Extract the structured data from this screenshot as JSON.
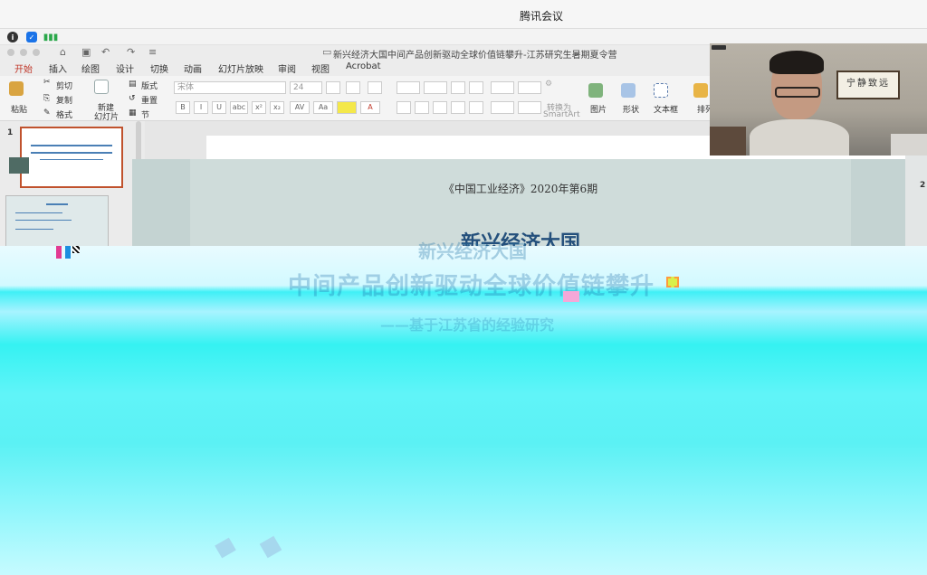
{
  "window": {
    "app_title": "腾讯会议"
  },
  "meeting_toolbar": {
    "info_icon": "info-icon",
    "shield_icon": "shield-icon",
    "signal_icon": "signal-icon"
  },
  "ppt": {
    "doc_title": "新兴经济大国中间产品创新驱动全球价值链攀升-江苏研究生暑期夏令营",
    "tabs": [
      "开始",
      "插入",
      "绘图",
      "设计",
      "切换",
      "动画",
      "幻灯片放映",
      "审阅",
      "视图",
      "Acrobat"
    ],
    "ribbon": {
      "paste": "粘贴",
      "cut": "剪切",
      "copy": "复制",
      "format": "格式",
      "new_slide_line1": "新建",
      "new_slide_line2": "幻灯片",
      "layout": "版式",
      "reset": "重置",
      "section": "节",
      "font_name": "宋体",
      "font_size": "24",
      "convert_line1": "转换为",
      "convert_line2": "SmartArt",
      "picture": "图片",
      "shape": "形状",
      "textbox": "文本框",
      "arrange": "排列"
    },
    "thumbnails": {
      "slide1_num": "1",
      "slide2_num": "2"
    },
    "slide": {
      "journal": "《中国工业经济》2020年第6期",
      "title": "新兴经济大国"
    },
    "glitch_text": {
      "line1": "新兴经济大国",
      "line2": "中间产品创新驱动全球价值链攀升",
      "line3": "——基于江苏省的经验研究"
    }
  },
  "video": {
    "scroll_text": "宁静致远"
  },
  "colors": {
    "accent": "#c0392b",
    "cyan_glitch": "#3ff0f6",
    "title_blue": "#24507c"
  }
}
